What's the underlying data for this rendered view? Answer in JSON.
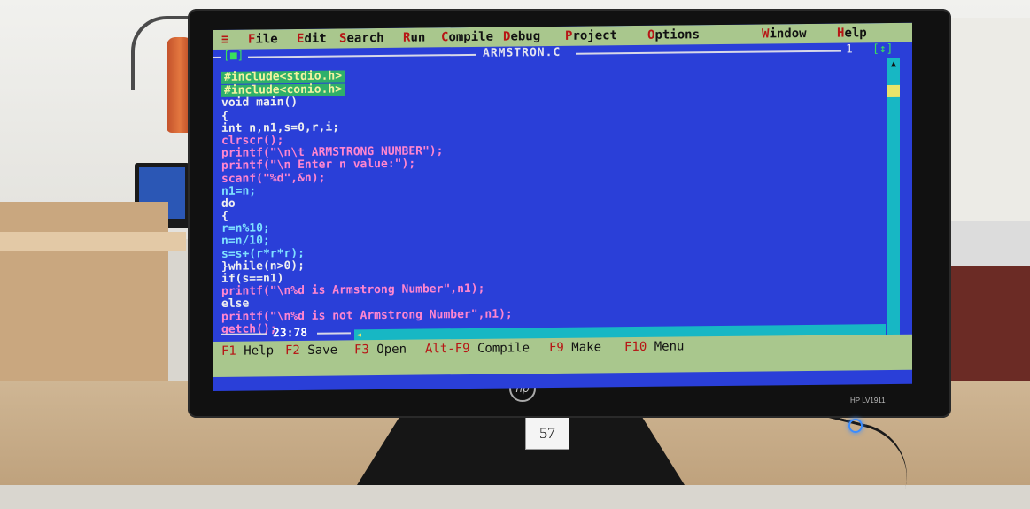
{
  "menu": {
    "system": "≡",
    "items": [
      {
        "hot": "F",
        "rest": "ile"
      },
      {
        "hot": "E",
        "rest": "dit"
      },
      {
        "hot": "S",
        "rest": "earch"
      },
      {
        "hot": "R",
        "rest": "un"
      },
      {
        "hot": "C",
        "rest": "ompile"
      },
      {
        "hot": "D",
        "rest": "ebug"
      },
      {
        "hot": "P",
        "rest": "roject"
      },
      {
        "hot": "O",
        "rest": "ptions"
      },
      {
        "hot": "W",
        "rest": "indow"
      },
      {
        "hot": "H",
        "rest": "elp"
      }
    ]
  },
  "window": {
    "close_box": "[■]",
    "filename": "ARMSTRON.C",
    "number": "1",
    "zoom_box": "[↕]"
  },
  "code_lines": [
    "#include<stdio.h>",
    "#include<conio.h>",
    "void main()",
    "{",
    "int n,n1,s=0,r,i;",
    "clrscr();",
    "printf(\"\\n\\t ARMSTRONG NUMBER\");",
    "printf(\"\\n Enter n value:\");",
    "scanf(\"%d\",&n);",
    "n1=n;",
    "do",
    "{",
    "r=n%10;",
    "n=n/10;",
    "s=s+(r*r*r);",
    "}while(n>0);",
    "if(s==n1)",
    "printf(\"\\n%d is Armstrong Number\",n1);",
    "else",
    "printf(\"\\n%d is not Armstrong Number\",n1);",
    "getch();"
  ],
  "status": {
    "cursor_position": "23:78"
  },
  "function_keys": [
    {
      "key": "F1",
      "label": "Help"
    },
    {
      "key": "F2",
      "label": "Save"
    },
    {
      "key": "F3",
      "label": "Open"
    },
    {
      "key": "Alt-F9",
      "label": "Compile"
    },
    {
      "key": "F9",
      "label": "Make"
    },
    {
      "key": "F10",
      "label": "Menu"
    }
  ],
  "monitor": {
    "brand": "hp",
    "model": "HP LV1911",
    "sticker": "57"
  },
  "colors": {
    "editor_bg": "#2a3fd8",
    "menu_bg": "#a9c78d",
    "hotkey": "#b71515",
    "include_highlight": "#2fb06a",
    "scrollbar": "#17b7c4"
  }
}
